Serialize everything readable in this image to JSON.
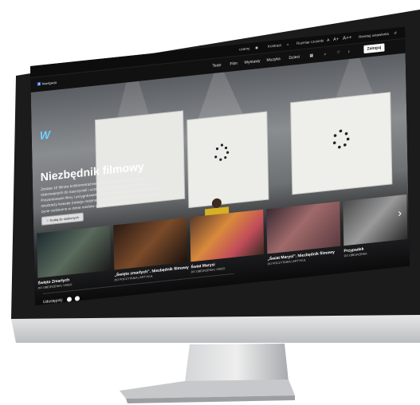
{
  "topbar": {
    "contrast_label": "Kontrast",
    "size_label": "Rozmiar czcionki",
    "size_options": [
      "A",
      "A+",
      "A++"
    ],
    "reset_label": "Resetuj ustawienia",
    "extra_label": "czarny"
  },
  "nav": {
    "items": [
      "Teatr",
      "Film",
      "Wystawy",
      "Muzyka",
      "Dzieci"
    ],
    "login": "Zaloguj"
  },
  "a11y_label": "Nawigacja",
  "hero": {
    "title": "Niezbędnik filmowy",
    "description": "Zestaw 10 filmów krótkometrażowych i materiałów edukacyjnych skierowanych do nauczycieli i uczniów szkół ponadpodstawowych. Prezentowane filmy i przygotowane do nich materiały poruszają istotne dla młodzieży kwestie (relacje rodzinne, konflikty z rówieśnikami, uzależnienia, życie codzienne w dobie mediów społecznościowych).",
    "add_button": "Dodaj do ulubionych"
  },
  "cards": [
    {
      "title": "Święto Zmarłych",
      "meta": "DO OBEJRZENIA | VIDEO"
    },
    {
      "title": "„Święto zmarłych”. Niezbędnik filmowy",
      "meta": "DO POCZYTANIA | ARTYKUŁ"
    },
    {
      "title": "Świat Marysi",
      "meta": "DO OBEJRZENIA | VIDEO"
    },
    {
      "title": "„Świat Marysi”. Niezbędnik filmowy",
      "meta": "DO POCZYTANIA | ARTYKUŁ"
    },
    {
      "title": "Przypadek",
      "meta": "DO OBEJRZENIA"
    }
  ],
  "share_label": "Udostępnij:",
  "colors": {
    "accent": "#6fd0ff",
    "bg": "#0b0b0c"
  }
}
